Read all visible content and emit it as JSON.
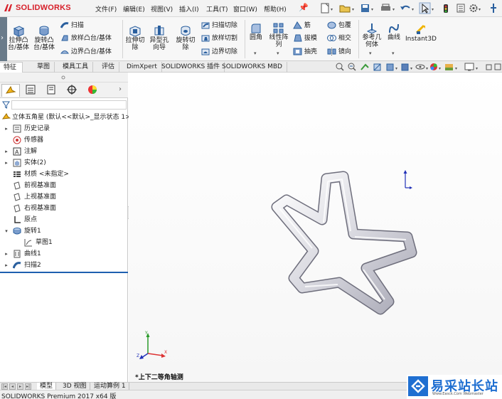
{
  "app": {
    "name": "SOLIDWORKS"
  },
  "menu": [
    "文件(F)",
    "编辑(E)",
    "视图(V)",
    "插入(I)",
    "工具(T)",
    "窗口(W)",
    "帮助(H)"
  ],
  "ribbon": {
    "extrude_boss": "拉伸凸台/基体",
    "revolve_boss": "旋转凸台/基体",
    "sweep": "扫描",
    "loft_boss": "放样凸台/基体",
    "boundary_boss": "边界凸台/基体",
    "extrude_cut": "拉伸切除",
    "hole_wizard": "异型孔向导",
    "revolve_cut": "旋转切除",
    "sweep_cut": "扫描切除",
    "loft_cut": "放样切割",
    "boundary_cut": "边界切除",
    "fillet": "圆角",
    "linear_pattern": "线性阵列",
    "rib": "筋",
    "draft": "拔模",
    "shell": "抽壳",
    "wrap": "包覆",
    "intersect": "相交",
    "mirror": "镜向",
    "ref_geometry": "参考几何体",
    "curves": "曲线",
    "instant3d": "Instant3D"
  },
  "tabs": [
    "特征",
    "草图",
    "模具工具",
    "评估",
    "DimXpert",
    "SOLIDWORKS 插件",
    "SOLIDWORKS MBD"
  ],
  "tree": {
    "root": "立体五角星 (默认<<默认>_显示状态 1>",
    "items": [
      {
        "label": "历史记录",
        "icon": "history-icon",
        "expandable": true
      },
      {
        "label": "传感器",
        "icon": "sensor-icon",
        "expandable": false
      },
      {
        "label": "注解",
        "icon": "annotation-icon",
        "expandable": true
      },
      {
        "label": "实体(2)",
        "icon": "solid-bodies-icon",
        "expandable": true
      },
      {
        "label": "材质 <未指定>",
        "icon": "material-icon",
        "expandable": false
      },
      {
        "label": "前视基准面",
        "icon": "plane-icon",
        "expandable": false
      },
      {
        "label": "上视基准面",
        "icon": "plane-icon",
        "expandable": false
      },
      {
        "label": "右视基准面",
        "icon": "plane-icon",
        "expandable": false
      },
      {
        "label": "原点",
        "icon": "origin-icon",
        "expandable": false
      },
      {
        "label": "旋转1",
        "icon": "revolve-feature-icon",
        "expandable": true
      },
      {
        "label": "草图1",
        "icon": "sketch-icon",
        "expandable": false
      },
      {
        "label": "曲线1",
        "icon": "curve-icon",
        "expandable": true
      },
      {
        "label": "扫描2",
        "icon": "sweep-feature-icon",
        "expandable": true
      }
    ]
  },
  "viewport": {
    "view_name": "*上下二等角轴测"
  },
  "bottom_tabs": [
    "模型",
    "3D 视图",
    "运动算例 1"
  ],
  "status": "SOLIDWORKS Premium 2017 x64 版",
  "watermark": {
    "main": "易采站长站",
    "sub": "Www.Easck.Com Webmaster"
  },
  "colors": {
    "brand_red": "#d7202a",
    "accent_blue": "#1e5fb0",
    "watermark_blue": "#1f6fd1"
  }
}
